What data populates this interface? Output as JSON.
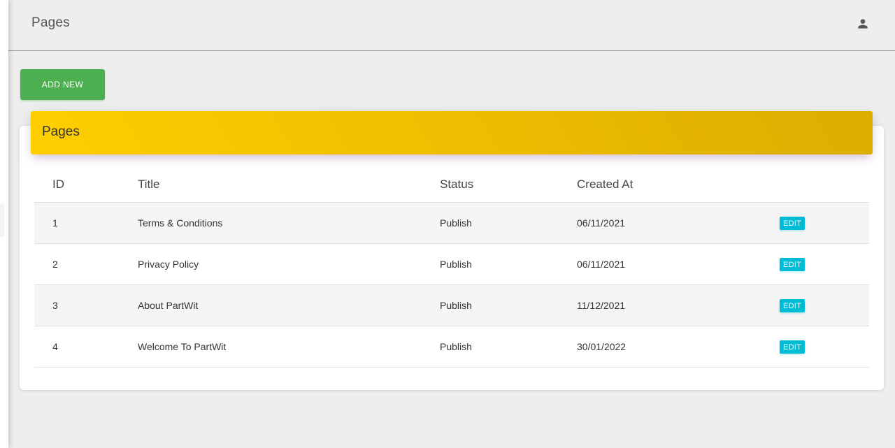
{
  "navbar": {
    "title": "Pages",
    "user_icon": "person-icon"
  },
  "actions": {
    "add_new_label": "ADD NEW"
  },
  "card": {
    "title": "Pages",
    "header_colors": [
      "#ffcf00",
      "#dcad00"
    ]
  },
  "table": {
    "columns": [
      "ID",
      "Title",
      "Status",
      "Created At",
      ""
    ],
    "rows": [
      {
        "id": "1",
        "title": "Terms & Conditions",
        "status": "Publish",
        "created_at": "06/11/2021",
        "action": "EDIT"
      },
      {
        "id": "2",
        "title": "Privacy Policy",
        "status": "Publish",
        "created_at": "06/11/2021",
        "action": "EDIT"
      },
      {
        "id": "3",
        "title": "About PartWit",
        "status": "Publish",
        "created_at": "11/12/2021",
        "action": "EDIT"
      },
      {
        "id": "4",
        "title": "Welcome To PartWit",
        "status": "Publish",
        "created_at": "30/01/2022",
        "action": "EDIT"
      }
    ]
  },
  "colors": {
    "add_button": "#4caf50",
    "edit_button": "#00bcd4",
    "background": "#eeeeee"
  }
}
